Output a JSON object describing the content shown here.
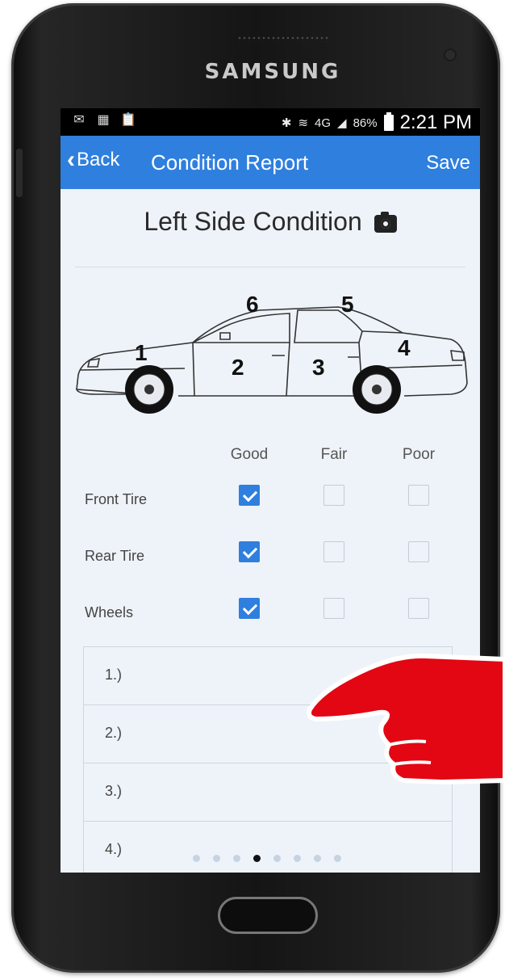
{
  "device": {
    "brand": "SAMSUNG"
  },
  "status_bar": {
    "battery": "86%",
    "time": "2:21 PM",
    "network": "4G"
  },
  "nav": {
    "back_label": "Back",
    "title": "Condition Report",
    "save_label": "Save"
  },
  "section": {
    "title": "Left Side Condition"
  },
  "diagram": {
    "markers": [
      "1",
      "2",
      "3",
      "4",
      "5",
      "6"
    ]
  },
  "conditions": {
    "columns": [
      "Good",
      "Fair",
      "Poor"
    ],
    "rows": [
      {
        "label": "Front Tire",
        "selected": "Good"
      },
      {
        "label": "Rear Tire",
        "selected": "Good"
      },
      {
        "label": "Wheels",
        "selected": "Good"
      }
    ]
  },
  "notes": [
    {
      "label": "1.)"
    },
    {
      "label": "2.)"
    },
    {
      "label": "3.)"
    },
    {
      "label": "4.)"
    }
  ],
  "pager": {
    "total": 8,
    "active_index": 3
  },
  "colors": {
    "nav_bar": "#2f7fde",
    "screen_bg": "#eef3f9",
    "hand": "#e30613"
  }
}
